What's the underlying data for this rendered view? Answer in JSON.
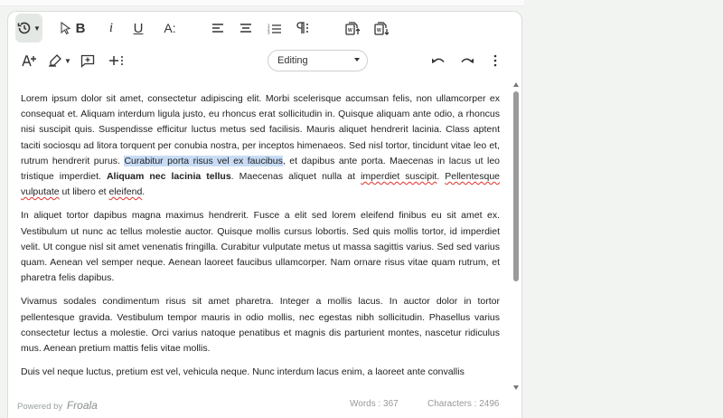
{
  "toolbar": {
    "history_label": "History",
    "bold_label": "B",
    "italic_label": "i",
    "underline_label": "U",
    "font_size_label": "A:",
    "mode_dropdown": {
      "selected": "Editing"
    }
  },
  "content": {
    "paragraphs": [
      {
        "before": "Lorem ipsum dolor sit amet, consectetur adipiscing elit. Morbi scelerisque accumsan felis, non ullamcorper ex consequat et. Aliquam interdum ligula justo, eu rhoncus erat sollicitudin in. Quisque aliquam ante odio, a rhoncus nisi suscipit quis. Suspendisse efficitur luctus metus sed facilisis. Mauris aliquet hendrerit lacinia. Class aptent taciti sociosqu ad litora torquent per conubia nostra, per inceptos himenaeos. Sed nisl tortor, tincidunt vitae leo et, rutrum hendrerit purus. ",
        "highlighted": "Curabitur porta risus vel ex faucibus",
        "middle": ", et dapibus ante porta. Maecenas in lacus ut leo tristique imperdiet. ",
        "bold": "Aliquam nec lacinia tellus",
        "after_a": ". Maecenas aliquet nulla at ",
        "misspelled_1": "imperdiet suscipit",
        "after_b": ". ",
        "misspelled_2": "Pellentesque vulputate",
        "after_c": " ut libero et ",
        "misspelled_3": "eleifend",
        "after_d": "."
      },
      "In aliquet tortor dapibus magna maximus hendrerit. Fusce a elit sed lorem eleifend finibus eu sit amet ex. Vestibulum ut nunc ac tellus molestie auctor. Quisque mollis cursus lobortis. Sed quis mollis tortor, id imperdiet velit. Ut congue nisl sit amet venenatis fringilla. Curabitur vulputate metus ut massa sagittis varius. Sed sed varius quam. Aenean vel semper neque. Aenean laoreet faucibus ullamcorper. Nam ornare risus vitae quam rutrum, et pharetra felis dapibus.",
      "Vivamus sodales condimentum risus sit amet pharetra. Integer a mollis lacus. In auctor dolor in tortor pellentesque gravida. Vestibulum tempor mauris in odio mollis, nec egestas nibh sollicitudin. Phasellus varius consectetur lectus a molestie. Orci varius natoque penatibus et magnis dis parturient montes, nascetur ridiculus mus. Aenean pretium mattis felis vitae mollis.",
      "Duis vel neque luctus, pretium est vel, vehicula neque. Nunc interdum lacus enim, a laoreet ante convallis"
    ]
  },
  "footer": {
    "powered_by": "Powered by",
    "brand": "Froala",
    "words": "Words : 367",
    "characters": "Characters : 2496"
  },
  "icons": [
    "history-icon",
    "pointer-icon",
    "bold-icon",
    "italic-icon",
    "underline-icon",
    "font-size-icon",
    "align-left-icon",
    "align-center-icon",
    "ordered-list-icon",
    "paragraph-format-icon",
    "export-icon",
    "import-icon",
    "text-color-icon",
    "highlight-icon",
    "insert-comment-icon",
    "more-insert-icon",
    "undo-icon",
    "redo-icon",
    "more-vertical-icon"
  ],
  "colors": {
    "highlight": "#c8dcf5",
    "spellcheck": "#e0302a",
    "active_button": "#e4e8e4"
  }
}
